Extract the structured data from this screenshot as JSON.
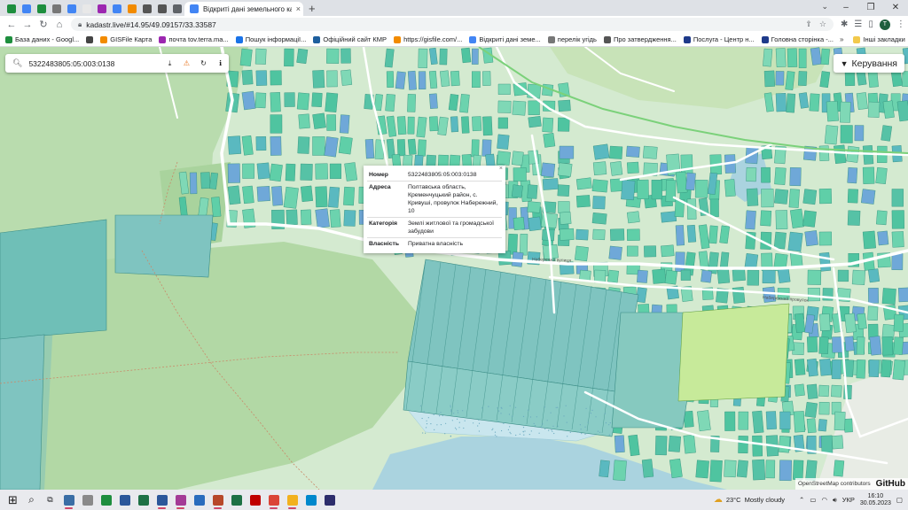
{
  "browser": {
    "active_tab_title": "Відкриті дані земельного кадастру",
    "tab_favicons": [
      "#1e8e3e",
      "#4285f4",
      "#1e8e3e",
      "#777777",
      "#4285f4",
      "#e8e8e8",
      "#9c27b0",
      "#4285f4",
      "#f28b00",
      "#555555",
      "#555555",
      "#5f6368"
    ],
    "url": "kadastr.live/#14.95/49.09157/33.33587",
    "bookmarks": [
      {
        "label": "База даних - Googl...",
        "color": "#1e8e3e"
      },
      {
        "label": "",
        "color": "#444444"
      },
      {
        "label": "GISFile Карта",
        "color": "#f28b00"
      },
      {
        "label": "почта tov.terra.ma...",
        "color": "#9c27b0"
      },
      {
        "label": "Пошук інформації...",
        "color": "#1a73e8"
      },
      {
        "label": "Офіційний сайт КМР",
        "color": "#1e5f9e"
      },
      {
        "label": "https://gisfile.com/...",
        "color": "#f28b00"
      },
      {
        "label": "Відкриті дані земе...",
        "color": "#4285f4"
      },
      {
        "label": "перелік угідь",
        "color": "#777777"
      },
      {
        "label": "Про затвердження...",
        "color": "#555555"
      },
      {
        "label": "Послуга - Центр н...",
        "color": "#1e3a8a"
      },
      {
        "label": "Головна сторінка -...",
        "color": "#1e3a8a"
      }
    ],
    "bookmarks_other": "Інші закладки"
  },
  "map": {
    "search_value": "5322483805:05:003:0138",
    "manage_label": "Керування",
    "popup": {
      "rows": [
        {
          "key": "Номер",
          "value": "5322483805:05:003:0138"
        },
        {
          "key": "Адреса",
          "value": "Полтавська область, Кременчуцький район, с. Кривуші, провулок Набережний, 10"
        },
        {
          "key": "Категорія",
          "value": "Землі житлової та громадської забудови"
        },
        {
          "key": "Власність",
          "value": "Приватна власність"
        }
      ]
    },
    "labels": {
      "street1": "Набережна вулиця",
      "street2": "Набережний провулок"
    },
    "attribution": "OpenStreetMap contributors",
    "github": "GitHub"
  },
  "taskbar": {
    "apps": [
      "#3a6ea5",
      "#8a8a8a",
      "#1e8e3e",
      "#2b579a",
      "#1e7145",
      "#2b579a",
      "#a43a96",
      "#2a6cbd",
      "#b7472a",
      "#1e7145",
      "#c00000",
      "#db4437",
      "#f2b11f",
      "#0088cc",
      "#2d2d6b"
    ],
    "open_apps": [
      0,
      5,
      6,
      8,
      11,
      12
    ],
    "weather_temp": "23°C",
    "weather_text": "Mostly cloudy",
    "lang": "УКР",
    "time": "16:10",
    "date": "30.05.2023"
  },
  "colors": {
    "parcel": "#5fcfa8",
    "parcel_blue": "#6fa8d8",
    "park": "#b8dcb0",
    "forest": "#a9d39d",
    "water": "#aad3df",
    "road": "#ffffff"
  }
}
